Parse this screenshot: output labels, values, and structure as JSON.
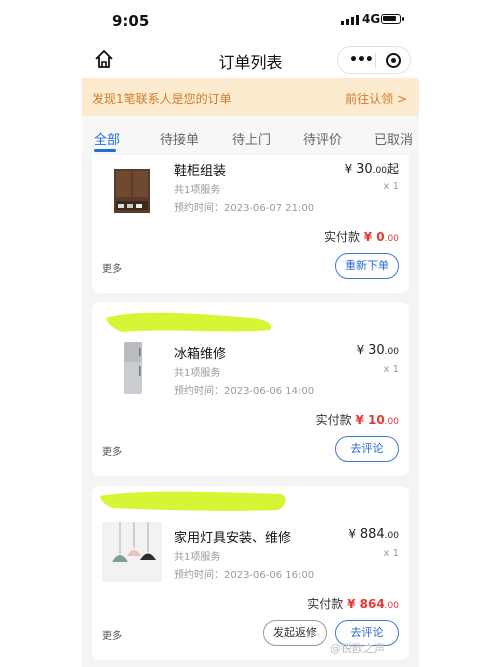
{
  "status": {
    "time": "9:05",
    "network": "4G"
  },
  "nav": {
    "title": "订单列表"
  },
  "banner": {
    "text": "发现1笔联系人是您的订单",
    "action": "前往认领 >"
  },
  "tabs": [
    "全部",
    "待接单",
    "待上门",
    "待评价",
    "已取消"
  ],
  "orders": [
    {
      "name": "鞋柜组装",
      "currency": "¥",
      "price_int": "30",
      "price_dec": ".00",
      "price_suffix": "起",
      "service": "共1项服务",
      "qty": "x 1",
      "time": "预约时间：2023-06-07 21:00",
      "paid_label": "实付款",
      "paid_int": "¥ 0",
      "paid_dec": ".00",
      "more": "更多",
      "buttons": [
        "重新下单"
      ]
    },
    {
      "name": "冰箱维修",
      "currency": "¥",
      "price_int": "30",
      "price_dec": ".00",
      "price_suffix": "",
      "service": "共1项服务",
      "qty": "x 1",
      "time": "预约时间：2023-06-06 14:00",
      "paid_label": "实付款",
      "paid_int": "¥ 10",
      "paid_dec": ".00",
      "more": "更多",
      "buttons": [
        "去评论"
      ]
    },
    {
      "name": "家用灯具安装、维修",
      "currency": "¥",
      "price_int": "884",
      "price_dec": ".00",
      "price_suffix": "",
      "service": "共1项服务",
      "qty": "x 1",
      "time": "预约时间：2023-06-06 16:00",
      "paid_label": "实付款",
      "paid_int": "¥ 864",
      "paid_dec": ".00",
      "more": "更多",
      "buttons": [
        "发起返修",
        "去评论"
      ]
    }
  ],
  "watermark": "@锐欧之声",
  "colors": {
    "accent": "#1f6fe0",
    "price_red": "#e53935",
    "banner_bg": "#fdebd0",
    "banner_text": "#cf7b2a",
    "highlight": "#d7f535"
  }
}
